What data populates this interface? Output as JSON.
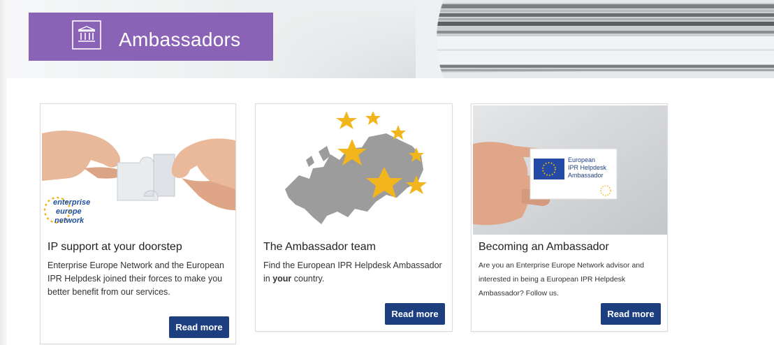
{
  "banner": {
    "title": "Ambassadors",
    "icon": "institution-icon",
    "accent_color": "#8a63b6"
  },
  "cards": [
    {
      "image_icon": "handshake-puzzle-image",
      "image_caption": [
        "enterprise",
        "europe",
        "network"
      ],
      "title": "IP support at your doorstep",
      "description": "Enterprise Europe Network and the European IPR Helpdesk joined their forces to make you better benefit from our services.",
      "button_label": "Read more"
    },
    {
      "image_icon": "europe-map-stars-image",
      "title": "The Ambassador team",
      "description_part1": "Find the European IPR Helpdesk Ambassador in ",
      "description_bold": "your",
      "description_part2": " country.",
      "button_label": "Read more"
    },
    {
      "image_icon": "ambassador-card-image",
      "card_text": [
        "European",
        "IPR Helpdesk",
        "Ambassador"
      ],
      "title": "Becoming an Ambassador",
      "description": "Are you an Enterprise Europe Network advisor and interested in being a European IPR Helpdesk Ambassador? Follow us.",
      "button_label": "Read more"
    }
  ],
  "colors": {
    "button": "#1d3f80",
    "star": "#f2b51c"
  }
}
